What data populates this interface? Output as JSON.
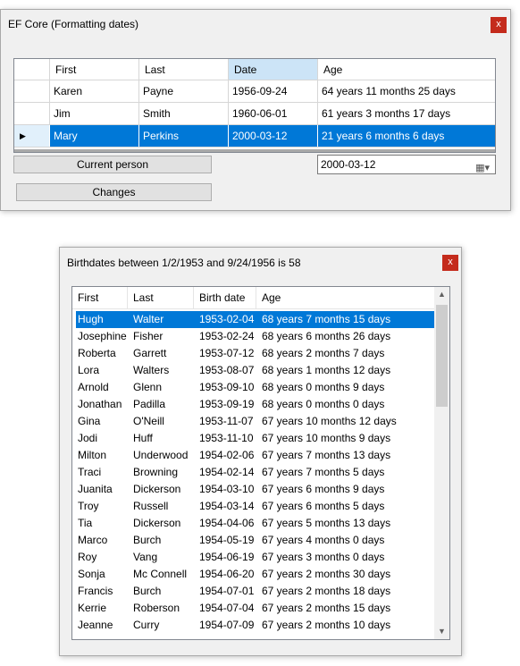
{
  "window1": {
    "title": "EF Core (Formatting dates)",
    "close": "x",
    "columns": [
      "First",
      "Last",
      "Date",
      "Age"
    ],
    "rows": [
      {
        "first": "Karen",
        "last": "Payne",
        "date": "1956-09-24",
        "age": "64 years 11 months 25 days"
      },
      {
        "first": "Jim",
        "last": "Smith",
        "date": "1960-06-01",
        "age": "61 years 3 months 17 days"
      },
      {
        "first": "Mary",
        "last": "Perkins",
        "date": "2000-03-12",
        "age": "21 years 6 months 6 days"
      }
    ],
    "current_row_marker": "▶",
    "current_person_label": "Current person",
    "changes_label": "Changes",
    "date_value": "2000-03-12"
  },
  "window2": {
    "title": "Birthdates between 1/2/1953 and 9/24/1956 is 58",
    "close": "x",
    "columns": [
      "First",
      "Last",
      "Birth date",
      "Age"
    ],
    "rows": [
      {
        "first": "Hugh",
        "last": "Walter",
        "date": "1953-02-04",
        "age": "68 years 7 months 15 days"
      },
      {
        "first": "Josephine",
        "last": "Fisher",
        "date": "1953-02-24",
        "age": "68 years 6 months 26 days"
      },
      {
        "first": "Roberta",
        "last": "Garrett",
        "date": "1953-07-12",
        "age": "68 years 2 months 7 days"
      },
      {
        "first": "Lora",
        "last": "Walters",
        "date": "1953-08-07",
        "age": "68 years 1 months 12 days"
      },
      {
        "first": "Arnold",
        "last": "Glenn",
        "date": "1953-09-10",
        "age": "68 years 0 months 9 days"
      },
      {
        "first": "Jonathan",
        "last": "Padilla",
        "date": "1953-09-19",
        "age": "68 years 0 months 0 days"
      },
      {
        "first": "Gina",
        "last": "O'Neill",
        "date": "1953-11-07",
        "age": "67 years 10 months 12 days"
      },
      {
        "first": "Jodi",
        "last": "Huff",
        "date": "1953-11-10",
        "age": "67 years 10 months 9 days"
      },
      {
        "first": "Milton",
        "last": "Underwood",
        "date": "1954-02-06",
        "age": "67 years 7 months 13 days"
      },
      {
        "first": "Traci",
        "last": "Browning",
        "date": "1954-02-14",
        "age": "67 years 7 months 5 days"
      },
      {
        "first": "Juanita",
        "last": "Dickerson",
        "date": "1954-03-10",
        "age": "67 years 6 months 9 days"
      },
      {
        "first": "Troy",
        "last": "Russell",
        "date": "1954-03-14",
        "age": "67 years 6 months 5 days"
      },
      {
        "first": "Tia",
        "last": "Dickerson",
        "date": "1954-04-06",
        "age": "67 years 5 months 13 days"
      },
      {
        "first": "Marco",
        "last": "Burch",
        "date": "1954-05-19",
        "age": "67 years 4 months 0 days"
      },
      {
        "first": "Roy",
        "last": "Vang",
        "date": "1954-06-19",
        "age": "67 years 3 months 0 days"
      },
      {
        "first": "Sonja",
        "last": "Mc Connell",
        "date": "1954-06-20",
        "age": "67 years 2 months 30 days"
      },
      {
        "first": "Francis",
        "last": "Burch",
        "date": "1954-07-01",
        "age": "67 years 2 months 18 days"
      },
      {
        "first": "Kerrie",
        "last": "Roberson",
        "date": "1954-07-04",
        "age": "67 years 2 months 15 days"
      },
      {
        "first": "Jeanne",
        "last": "Curry",
        "date": "1954-07-09",
        "age": "67 years 2 months 10 days"
      }
    ]
  },
  "icons": {
    "calendar": "calendar-icon",
    "scroll_up": "chevron-up-icon",
    "scroll_down": "chevron-down-icon",
    "close": "close-icon"
  },
  "colors": {
    "selection": "#0078d7",
    "close_button": "#c42b1c",
    "header_selected": "#cce4f7"
  }
}
